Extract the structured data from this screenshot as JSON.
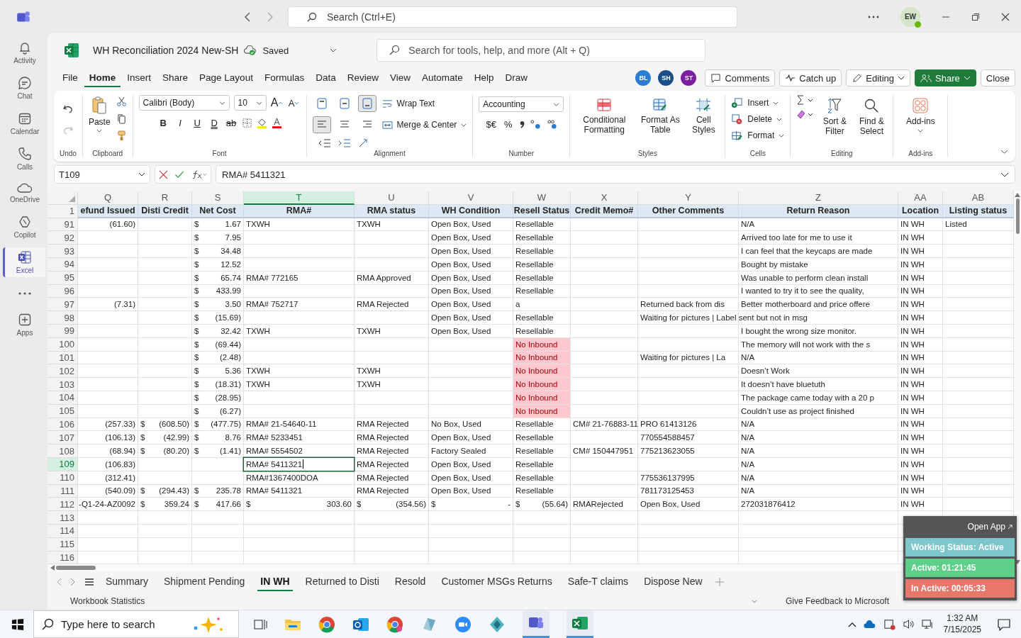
{
  "titlebar": {
    "search": {
      "placeholder": "Search (Ctrl+E)"
    },
    "avatar": "EW"
  },
  "rail": [
    {
      "label": "Activity",
      "selected": false
    },
    {
      "label": "Chat",
      "selected": false
    },
    {
      "label": "Calendar",
      "selected": false
    },
    {
      "label": "Calls",
      "selected": false
    },
    {
      "label": "OneDrive",
      "selected": false
    },
    {
      "label": "Copilot",
      "selected": false
    },
    {
      "label": "Excel",
      "selected": true
    },
    {
      "selected": false
    },
    {
      "label": "Apps",
      "selected": false
    }
  ],
  "document": {
    "title": "WH Reconciliation 2024 New-SH",
    "status": "Saved"
  },
  "command_search": {
    "placeholder": "Search for tools, help, and more (Alt + Q)"
  },
  "menu": [
    {
      "label": "File",
      "selected": false
    },
    {
      "label": "Home",
      "selected": true
    },
    {
      "label": "Insert",
      "selected": false
    },
    {
      "label": "Share",
      "selected": false
    },
    {
      "label": "Page Layout",
      "selected": false
    },
    {
      "label": "Formulas",
      "selected": false
    },
    {
      "label": "Data",
      "selected": false
    },
    {
      "label": "Review",
      "selected": false
    },
    {
      "label": "View",
      "selected": false
    },
    {
      "label": "Automate",
      "selected": false
    },
    {
      "label": "Help",
      "selected": false
    },
    {
      "label": "Draw",
      "selected": false
    }
  ],
  "collaborators": [
    {
      "initials": "BL",
      "color": "#2b7cd3"
    },
    {
      "initials": "SH",
      "color": "#1b4f8a"
    },
    {
      "initials": "ST",
      "color": "#7a1fa2"
    }
  ],
  "actions": {
    "comments": "Comments",
    "catch_up": "Catch up",
    "editing": "Editing",
    "share": "Share",
    "close": "Close"
  },
  "ribbon": {
    "undo": {
      "group": "Undo",
      "redo_disabled": true
    },
    "clipboard": {
      "group": "Clipboard",
      "paste": "Paste"
    },
    "font": {
      "group": "Font",
      "family": "Calibri (Body)",
      "size": "10",
      "grow": "A",
      "shrink": "A",
      "styles": [
        "B",
        "I",
        "U",
        "D",
        "ab"
      ]
    },
    "alignment": {
      "group": "Alignment",
      "vertical": [
        {
          "selected": false
        },
        {
          "selected": false
        },
        {
          "selected": true
        }
      ],
      "horizontal": [
        {
          "selected": true
        },
        {
          "selected": false
        },
        {
          "selected": false
        }
      ],
      "wrap": "Wrap Text",
      "merge": "Merge & Center"
    },
    "number": {
      "group": "Number",
      "format": "Accounting",
      "currency": "$€",
      "percent": "%"
    },
    "styles": {
      "group": "Styles",
      "conditional": "Conditional Formatting",
      "table": "Format As Table",
      "cell": "Cell Styles"
    },
    "cells": {
      "group": "Cells",
      "insert": "Insert",
      "delete": "Delete",
      "format": "Format"
    },
    "editing": {
      "group": "Editing",
      "sort": "Sort & Filter",
      "find": "Find & Select"
    },
    "addins": {
      "group": "Add-ins",
      "button": "Add-ins"
    }
  },
  "formula_bar": {
    "name_box": "T109",
    "formula": "RMA# 5411321"
  },
  "sheet": {
    "columns": [
      {
        "letter": "Q",
        "title": "efund Issued",
        "selected": false
      },
      {
        "letter": "R",
        "title": "Disti Credit",
        "selected": false
      },
      {
        "letter": "S",
        "title": "Net Cost",
        "selected": false
      },
      {
        "letter": "T",
        "title": "RMA#",
        "selected": true
      },
      {
        "letter": "U",
        "title": "RMA status",
        "selected": false
      },
      {
        "letter": "V",
        "title": "WH Condition",
        "selected": false
      },
      {
        "letter": "W",
        "title": "Resell Status",
        "selected": false
      },
      {
        "letter": "X",
        "title": "Credit Memo#",
        "selected": false
      },
      {
        "letter": "Y",
        "title": "Other Comments",
        "selected": false
      },
      {
        "letter": "Z",
        "title": "Return Reason",
        "selected": false
      },
      {
        "letter": "AA",
        "title": "Location",
        "selected": false
      },
      {
        "letter": "AB",
        "title": "Listing status",
        "selected": false
      }
    ],
    "header_row": "1",
    "rows": [
      {
        "num": "91",
        "selected": false,
        "cells": [
          {
            "kind": "number",
            "text": "(61.60)"
          },
          null,
          {
            "kind": "accounting",
            "currency": "$",
            "amount": "1.67"
          },
          "TXWH",
          "TXWH",
          "Open Box, Used",
          "Resellable",
          null,
          null,
          "N/A",
          "IN WH",
          "Listed"
        ]
      },
      {
        "num": "92",
        "selected": false,
        "cells": [
          null,
          null,
          {
            "kind": "accounting",
            "currency": "$",
            "amount": "7.95"
          },
          null,
          null,
          "Open Box, Used",
          "Resellable",
          null,
          null,
          "Arrived too late for me to use it",
          "IN WH",
          null
        ]
      },
      {
        "num": "93",
        "selected": false,
        "cells": [
          null,
          null,
          {
            "kind": "accounting",
            "currency": "$",
            "amount": "34.48"
          },
          null,
          null,
          "Open Box, Used",
          "Resellable",
          null,
          null,
          "I can feel that the keycaps are made",
          "IN WH",
          null
        ]
      },
      {
        "num": "94",
        "selected": false,
        "cells": [
          null,
          null,
          {
            "kind": "accounting",
            "currency": "$",
            "amount": "12.52"
          },
          null,
          null,
          "Open Box, Used",
          "Resellable",
          null,
          null,
          "Bought by mistake",
          "IN WH",
          null
        ]
      },
      {
        "num": "95",
        "selected": false,
        "cells": [
          null,
          null,
          {
            "kind": "accounting",
            "currency": "$",
            "amount": "65.74"
          },
          "RMA# 772165",
          "RMA Approved",
          "Open Box, Used",
          "Resellable",
          null,
          null,
          "Was unable to perform clean install",
          "IN WH",
          null
        ]
      },
      {
        "num": "96",
        "selected": false,
        "cells": [
          null,
          null,
          {
            "kind": "accounting",
            "currency": "$",
            "amount": "433.99"
          },
          null,
          null,
          "Open Box, Used",
          "Resellable",
          null,
          null,
          "I wanted to try it to see the quality,",
          "IN WH",
          null
        ]
      },
      {
        "num": "97",
        "selected": false,
        "cells": [
          {
            "kind": "number",
            "text": "(7.31)"
          },
          null,
          {
            "kind": "accounting",
            "currency": "$",
            "amount": "3.50"
          },
          "RMA# 752717",
          "RMA Rejected",
          "Open Box, Used",
          "a",
          null,
          "Returned back from dis",
          "Better motherboard and price offere",
          "IN WH",
          null
        ]
      },
      {
        "num": "98",
        "selected": false,
        "cells": [
          null,
          null,
          {
            "kind": "accounting",
            "currency": "$",
            "amount": "(15.69)"
          },
          null,
          null,
          "Open Box, Used",
          "Resellable",
          null,
          "Waiting for pictures | Label sent but not in msg",
          null,
          "IN WH",
          null
        ]
      },
      {
        "num": "99",
        "selected": false,
        "cells": [
          null,
          null,
          {
            "kind": "accounting",
            "currency": "$",
            "amount": "32.42"
          },
          "TXWH",
          "TXWH",
          "Open Box, Used",
          "Resellable",
          null,
          null,
          "I bought the wrong size monitor.",
          "IN WH",
          null
        ]
      },
      {
        "num": "100",
        "selected": false,
        "cells": [
          null,
          null,
          {
            "kind": "accounting",
            "currency": "$",
            "amount": "(69.44)"
          },
          null,
          null,
          null,
          {
            "kind": "flag",
            "text": "No Inbound"
          },
          null,
          null,
          "The memory will not work with the s",
          "IN WH",
          null
        ]
      },
      {
        "num": "101",
        "selected": false,
        "cells": [
          null,
          null,
          {
            "kind": "accounting",
            "currency": "$",
            "amount": "(2.48)"
          },
          null,
          null,
          null,
          {
            "kind": "flag",
            "text": "No Inbound"
          },
          null,
          "Waiting for pictures | La",
          "N/A",
          "IN WH",
          null
        ]
      },
      {
        "num": "102",
        "selected": false,
        "cells": [
          null,
          null,
          {
            "kind": "accounting",
            "currency": "$",
            "amount": "5.36"
          },
          "TXWH",
          "TXWH",
          null,
          {
            "kind": "flag",
            "text": "No Inbound"
          },
          null,
          null,
          "Doesn’t Work",
          "IN WH",
          null
        ]
      },
      {
        "num": "103",
        "selected": false,
        "cells": [
          null,
          null,
          {
            "kind": "accounting",
            "currency": "$",
            "amount": "(18.31)"
          },
          "TXWH",
          "TXWH",
          null,
          {
            "kind": "flag",
            "text": "No Inbound"
          },
          null,
          null,
          "It doesn’t have bluetuth",
          "IN WH",
          null
        ]
      },
      {
        "num": "104",
        "selected": false,
        "cells": [
          null,
          null,
          {
            "kind": "accounting",
            "currency": "$",
            "amount": "(28.95)"
          },
          null,
          null,
          null,
          {
            "kind": "flag",
            "text": "No Inbound"
          },
          null,
          null,
          "The package came today with a 20 p",
          "IN WH",
          null
        ]
      },
      {
        "num": "105",
        "selected": false,
        "cells": [
          null,
          null,
          {
            "kind": "accounting",
            "currency": "$",
            "amount": "(6.27)"
          },
          null,
          null,
          null,
          {
            "kind": "flag",
            "text": "No Inbound"
          },
          null,
          null,
          "Couldn’t use as project finished",
          "IN WH",
          null
        ]
      },
      {
        "num": "106",
        "selected": false,
        "cells": [
          {
            "kind": "number",
            "text": "(257.33)"
          },
          {
            "kind": "accounting",
            "currency": "$",
            "amount": "(608.50)"
          },
          {
            "kind": "accounting",
            "currency": "$",
            "amount": "(477.75)"
          },
          "RMA# 21-54640-11",
          "RMA Rejected",
          "No Box, Used",
          "Resellable",
          "CM# 21-76883-11",
          "PRO 61413126",
          "N/A",
          "IN WH",
          null
        ]
      },
      {
        "num": "107",
        "selected": false,
        "cells": [
          {
            "kind": "number",
            "text": "(106.13)"
          },
          {
            "kind": "accounting",
            "currency": "$",
            "amount": "(42.99)"
          },
          {
            "kind": "accounting",
            "currency": "$",
            "amount": "8.76"
          },
          "RMA# 5233451",
          "RMA Rejected",
          "Open Box, Used",
          "Resellable",
          null,
          "770554588457",
          "N/A",
          "IN WH",
          null
        ]
      },
      {
        "num": "108",
        "selected": false,
        "cells": [
          {
            "kind": "number",
            "text": "(68.94)"
          },
          {
            "kind": "accounting",
            "currency": "$",
            "amount": "(80.20)"
          },
          {
            "kind": "accounting",
            "currency": "$",
            "amount": "(1.41)"
          },
          "RMA# 5554502",
          "RMA Rejected",
          "Factory Sealed",
          "Resellable",
          "CM# 150447951",
          "775213623055",
          "N/A",
          "IN WH",
          null
        ]
      },
      {
        "num": "109",
        "selected": true,
        "cells": [
          {
            "kind": "number",
            "text": "(106.83)"
          },
          null,
          null,
          "RMA# 5411321",
          "RMA Rejected",
          "Open Box, Used",
          "Resellable",
          null,
          null,
          "N/A",
          "IN WH",
          null
        ]
      },
      {
        "num": "110",
        "selected": false,
        "cells": [
          {
            "kind": "number",
            "text": "(312.41)"
          },
          null,
          null,
          "RMA#1367400DOA",
          "RMA Rejected",
          "Open Box, Used",
          "Resellable",
          null,
          "775536137995",
          "N/A",
          "IN WH",
          null
        ]
      },
      {
        "num": "111",
        "selected": false,
        "cells": [
          {
            "kind": "number",
            "text": "(540.09)"
          },
          {
            "kind": "accounting",
            "currency": "$",
            "amount": "(294.43)"
          },
          {
            "kind": "accounting",
            "currency": "$",
            "amount": "235.78"
          },
          "RMA# 5411321",
          "RMA Rejected",
          "Open Box, Used",
          "Resellable",
          null,
          "781173125453",
          "N/A",
          "IN WH",
          null
        ]
      },
      {
        "num": "112",
        "selected": false,
        "cells": [
          {
            "kind": "number",
            "text": "-Q1-24-AZ0092"
          },
          {
            "kind": "accounting",
            "currency": "$",
            "amount": "359.24"
          },
          {
            "kind": "accounting",
            "currency": "$",
            "amount": "417.66"
          },
          {
            "kind": "accounting",
            "currency": "$",
            "amount": "303.60"
          },
          {
            "kind": "accounting",
            "currency": "$",
            "amount": "(354.56)"
          },
          {
            "kind": "accounting",
            "currency": "$",
            "amount": "-"
          },
          {
            "kind": "accounting",
            "currency": "$",
            "amount": "(55.64)"
          },
          "RMARejected",
          "Open Box, Used",
          "272031876412",
          "IN WH",
          null
        ]
      },
      {
        "num": "113",
        "selected": false,
        "cells": [
          null,
          null,
          null,
          null,
          null,
          null,
          null,
          null,
          null,
          null,
          null,
          null
        ]
      },
      {
        "num": "114",
        "selected": false,
        "cells": [
          null,
          null,
          null,
          null,
          null,
          null,
          null,
          null,
          null,
          null,
          null,
          null
        ]
      },
      {
        "num": "115",
        "selected": false,
        "cells": [
          null,
          null,
          null,
          null,
          null,
          null,
          null,
          null,
          null,
          null,
          null,
          null
        ]
      },
      {
        "num": "116",
        "selected": false,
        "cells": [
          null,
          null,
          null,
          null,
          null,
          null,
          null,
          null,
          null,
          null,
          null,
          null
        ]
      }
    ]
  },
  "sheet_tabs": [
    {
      "label": "Summary",
      "selected": false
    },
    {
      "label": "Shipment Pending",
      "selected": false
    },
    {
      "label": "IN WH",
      "selected": true
    },
    {
      "label": "Returned to Disti",
      "selected": false
    },
    {
      "label": "Resold",
      "selected": false
    },
    {
      "label": "Customer MSGs Returns",
      "selected": false
    },
    {
      "label": "Safe-T claims",
      "selected": false
    },
    {
      "label": "Dispose New",
      "selected": false
    }
  ],
  "status_bar": {
    "left": "Workbook Statistics",
    "feedback": "Give Feedback to Microsoft"
  },
  "tracker": {
    "open": "Open App",
    "rows": [
      {
        "text": "Working Status: Active",
        "color": "#7cc6cc"
      },
      {
        "text": "Active: 01:21:45",
        "color": "#5dcf88"
      },
      {
        "text": "In Active: 00:05:33",
        "color": "#e7766b"
      }
    ]
  },
  "taskbar": {
    "search": {
      "placeholder": "Type here to search"
    },
    "time": "1:32 AM",
    "date": "7/15/2025"
  }
}
